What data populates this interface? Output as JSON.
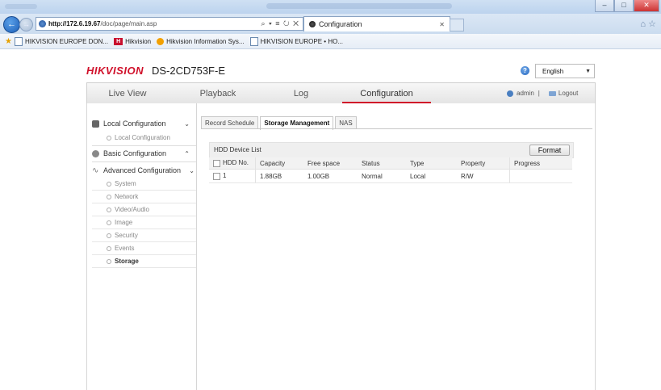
{
  "browser": {
    "url_host": "http://172.6.19.67",
    "url_path": "/doc/page/main.asp",
    "url_tools": "⌕ ▾ ≡ ↻ ✕",
    "tab_title": "Configuration",
    "favorites": [
      "HIKVISION EUROPE DON...",
      "Hikvision",
      "Hikvision Information Sys...",
      "HIKVISION EUROPE • HO..."
    ]
  },
  "header": {
    "logo": "HIKVISION",
    "model": "DS-2CD753F-E",
    "language": "English"
  },
  "nav": {
    "items": [
      "Live View",
      "Playback",
      "Log",
      "Configuration"
    ],
    "user": "admin",
    "separator": "|",
    "logout": "Logout"
  },
  "sidebar": {
    "local": {
      "label": "Local Configuration",
      "subs": [
        "Local Configuration"
      ]
    },
    "basic": {
      "label": "Basic Configuration"
    },
    "advanced": {
      "label": "Advanced Configuration",
      "subs": [
        "System",
        "Network",
        "Video/Audio",
        "Image",
        "Security",
        "Events",
        "Storage"
      ]
    }
  },
  "subtabs": [
    "Record Schedule",
    "Storage Management",
    "NAS"
  ],
  "hdd": {
    "title": "HDD Device List",
    "format_label": "Format",
    "columns": [
      "HDD No.",
      "Capacity",
      "Free space",
      "Status",
      "Type",
      "Property",
      "Progress"
    ],
    "rows": [
      {
        "no": "1",
        "capacity": "1.88GB",
        "free": "1.00GB",
        "status": "Normal",
        "type": "Local",
        "property": "R/W",
        "progress": ""
      }
    ]
  }
}
